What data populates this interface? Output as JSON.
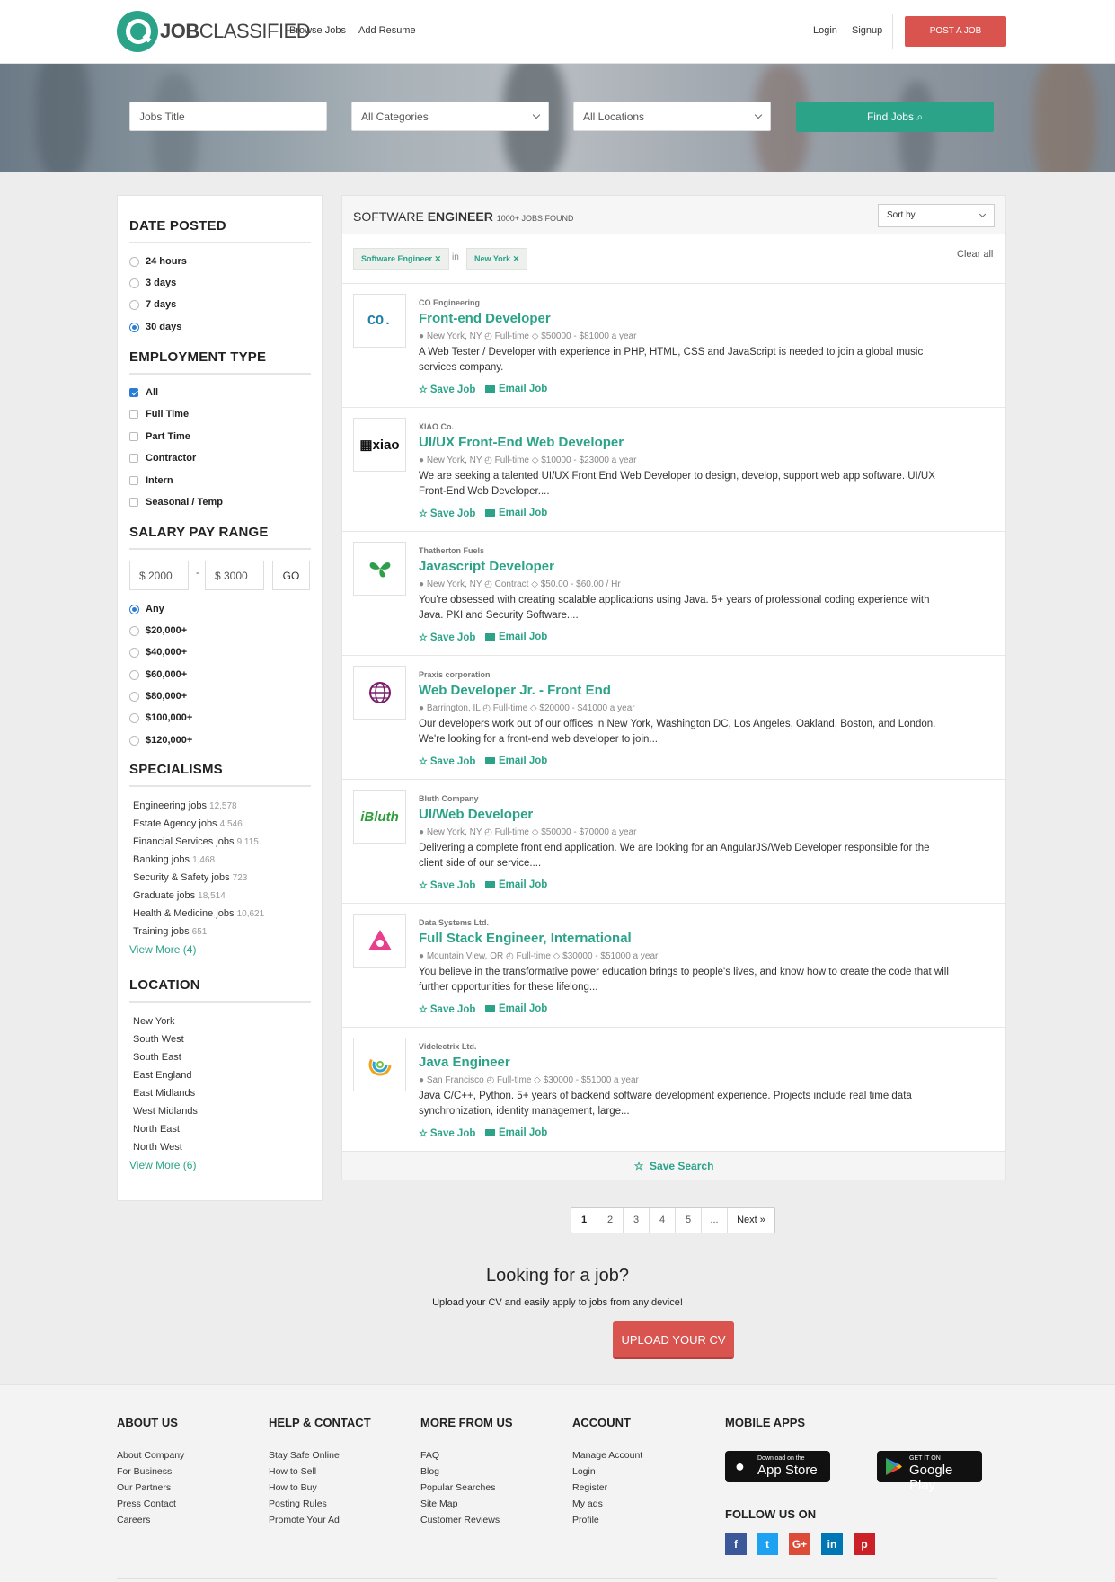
{
  "header": {
    "logo_bold": "JOB",
    "logo_rest": "CLASSIFIED",
    "nav": [
      "Browse Jobs",
      "Add Resume"
    ],
    "login": "Login",
    "signup": "Signup",
    "post_job": "POST A JOB"
  },
  "search": {
    "title_placeholder": "Jobs Title",
    "category": "All Categories",
    "location": "All Locations",
    "find": "Find Jobs"
  },
  "sidebar": {
    "date_posted": {
      "heading": "DATE POSTED",
      "options": [
        "24 hours",
        "3 days",
        "7 days",
        "30 days"
      ],
      "selected": "30 days"
    },
    "employment_type": {
      "heading": "EMPLOYMENT TYPE",
      "options": [
        "All",
        "Full Time",
        "Part Time",
        "Contractor",
        "Intern",
        "Seasonal / Temp"
      ],
      "checked": [
        "All"
      ]
    },
    "salary": {
      "heading": "SALARY PAY RANGE",
      "min": "$ 2000",
      "dash": "-",
      "max": "$ 3000",
      "go": "GO",
      "options": [
        "Any",
        "$20,000+",
        "$40,000+",
        "$60,000+",
        "$80,000+",
        "$100,000+",
        "$120,000+"
      ],
      "selected": "Any"
    },
    "specialisms": {
      "heading": "SPECIALISMS",
      "items": [
        {
          "label": "Engineering jobs",
          "count": "12,578"
        },
        {
          "label": "Estate Agency jobs",
          "count": "4,546"
        },
        {
          "label": "Financial Services jobs",
          "count": "9,115"
        },
        {
          "label": "Banking jobs",
          "count": "1,468"
        },
        {
          "label": "Security & Safety jobs",
          "count": "723"
        },
        {
          "label": "Graduate jobs",
          "count": "18,514"
        },
        {
          "label": "Health & Medicine jobs",
          "count": "10,621"
        },
        {
          "label": "Training jobs",
          "count": "651"
        }
      ],
      "view_more": "View More (4)"
    },
    "location": {
      "heading": "LOCATION",
      "items": [
        "New York",
        "South West",
        "South East",
        "East England",
        "East Midlands",
        "West Midlands",
        "North East",
        "North West"
      ],
      "view_more": "View More (6)"
    }
  },
  "results": {
    "title_a": "SOFTWARE ",
    "title_b": "ENGINEER",
    "count": "1000+ JOBS FOUND",
    "sort": "Sort by",
    "tags": [
      "Software Engineer",
      "New York"
    ],
    "in": "in",
    "clear_all": "Clear all",
    "save_label": "Save Job",
    "email_label": "Email Job",
    "save_search": "Save Search",
    "jobs": [
      {
        "company": "CO Engineering",
        "title": "Front-end Developer",
        "location": "New York, NY",
        "type": "Full-time",
        "salary": "$50000 - $81000 a year",
        "desc": "A Web Tester / Developer with experience in PHP, HTML, CSS and JavaScript is needed to join a global music services company.",
        "logo": "CO."
      },
      {
        "company": "XIAO Co.",
        "title": "UI/UX Front-End Web Developer",
        "location": "New York, NY",
        "type": "Full-time",
        "salary": "$10000 - $23000 a year",
        "desc": "We are seeking a talented UI/UX Front End Web Developer to design, develop, support web app software. UI/UX Front-End Web Developer....",
        "logo": "xiao"
      },
      {
        "company": "Thatherton Fuels",
        "title": "Javascript Developer",
        "location": "New York, NY",
        "type": "Contract",
        "salary": "$50.00 - $60.00 / Hr",
        "desc": "You're obsessed with creating scalable applications using Java. 5+ years of professional coding experience with Java. PKI and Security Software....",
        "logo": "leaf"
      },
      {
        "company": "Praxis corporation",
        "title": "Web Developer Jr. - Front End",
        "location": "Barrington, IL",
        "type": "Full-time",
        "salary": "$20000 - $41000 a year",
        "desc": "Our developers work out of our offices in New York, Washington DC, Los Angeles, Oakland, Boston, and London. We're looking for a front-end web developer to join...",
        "logo": "globe"
      },
      {
        "company": "Bluth Company",
        "title": "UI/Web Developer",
        "location": "New York, NY",
        "type": "Full-time",
        "salary": "$50000 - $70000 a year",
        "desc": "Delivering a complete front end application. We are looking for an AngularJS/Web Developer responsible for the client side of our service....",
        "logo": "Bluth"
      },
      {
        "company": "Data Systems Ltd.",
        "title": "Full Stack Engineer, International",
        "location": "Mountain View, OR",
        "type": "Full-time",
        "salary": "$30000 - $51000 a year",
        "desc": "You believe in the transformative power education brings to people's lives, and know how to create the code that will further opportunities for these lifelong...",
        "logo": "triangle"
      },
      {
        "company": "Videlectrix Ltd.",
        "title": "Java Engineer",
        "location": "San Francisco",
        "type": "Full-time",
        "salary": "$30000 - $51000 a year",
        "desc": "Java C/C++, Python. 5+ years of backend software development experience. Projects include real time data synchronization, identity management, large...",
        "logo": "swirl"
      }
    ]
  },
  "pagination": {
    "pages": [
      "1",
      "2",
      "3",
      "4",
      "5",
      "..."
    ],
    "next": "Next »",
    "active": "1"
  },
  "cta": {
    "heading": "Looking for a job?",
    "text": "Upload your CV and easily apply to jobs from any device!",
    "button": "UPLOAD YOUR CV"
  },
  "footer": {
    "columns": [
      {
        "heading": "ABOUT US",
        "links": [
          "About Company",
          "For Business",
          "Our Partners",
          "Press Contact",
          "Careers"
        ]
      },
      {
        "heading": "HELP & CONTACT",
        "links": [
          "Stay Safe Online",
          "How to Sell",
          "How to Buy",
          "Posting Rules",
          "Promote Your Ad"
        ]
      },
      {
        "heading": "MORE FROM US",
        "links": [
          "FAQ",
          "Blog",
          "Popular Searches",
          "Site Map",
          "Customer Reviews"
        ]
      },
      {
        "heading": "ACCOUNT",
        "links": [
          "Manage Account",
          "Login",
          "Register",
          "My ads",
          "Profile"
        ]
      }
    ],
    "mobile_heading": "MOBILE APPS",
    "appstore_small": "Download on the",
    "appstore_big": "App Store",
    "gplay_small": "GET IT ON",
    "gplay_big": "Google Play",
    "follow": "FOLLOW US ON",
    "social": [
      {
        "icon": "facebook-icon",
        "glyph": "f",
        "color": "#3b5998"
      },
      {
        "icon": "twitter-icon",
        "glyph": "t",
        "color": "#1da1f2"
      },
      {
        "icon": "google-plus-icon",
        "glyph": "G+",
        "color": "#dd4b39"
      },
      {
        "icon": "linkedin-icon",
        "glyph": "in",
        "color": "#0077b5"
      },
      {
        "icon": "pinterest-icon",
        "glyph": "p",
        "color": "#cb2027"
      }
    ]
  },
  "colors": {
    "brand": "#2ba388",
    "accent": "#d9534f",
    "radio": "#2b7cd3"
  }
}
